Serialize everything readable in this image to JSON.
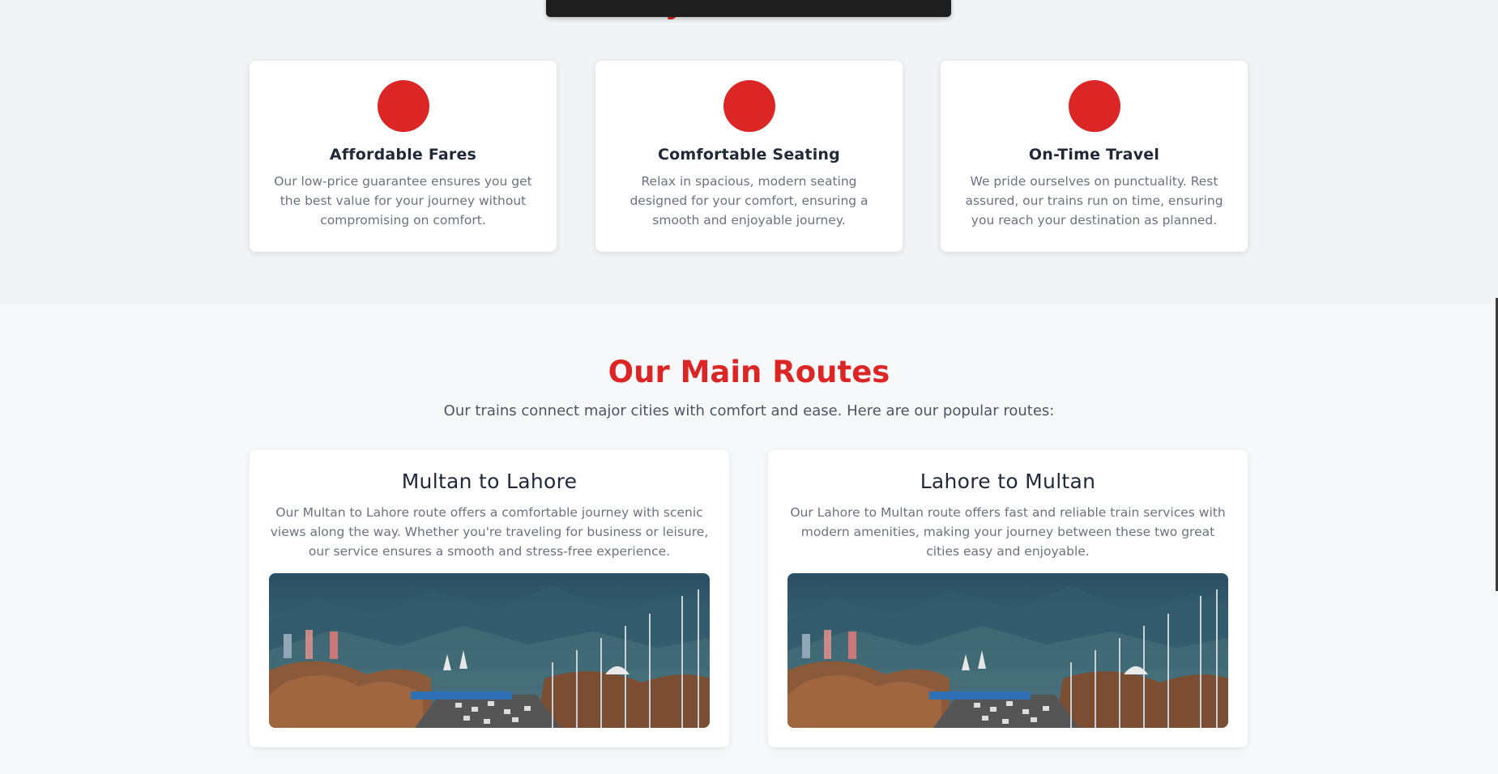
{
  "why": {
    "title": "Why Choose Us?",
    "accent_color": "#dc2626",
    "features": [
      {
        "icon": "red-circle-icon",
        "title": "Affordable Fares",
        "text": "Our low-price guarantee ensures you get the best value for your journey without compromising on comfort."
      },
      {
        "icon": "red-circle-icon",
        "title": "Comfortable Seating",
        "text": "Relax in spacious, modern seating designed for your comfort, ensuring a smooth and enjoyable journey."
      },
      {
        "icon": "red-circle-icon",
        "title": "On-Time Travel",
        "text": "We pride ourselves on punctuality. Rest assured, our trains run on time, ensuring you reach your destination as planned."
      }
    ]
  },
  "routes": {
    "title": "Our Main Routes",
    "subtitle": "Our trains connect major cities with comfort and ease. Here are our popular routes:",
    "items": [
      {
        "title": "Multan to Lahore",
        "text": "Our Multan to Lahore route offers a comfortable journey with scenic views along the way. Whether you're traveling for business or leisure, our service ensures a smooth and stress-free experience.",
        "image": "city-highway-photo"
      },
      {
        "title": "Lahore to Multan",
        "text": "Our Lahore to Multan route offers fast and reliable train services with modern amenities, making your journey between these two great cities easy and enjoyable.",
        "image": "city-highway-photo"
      }
    ]
  }
}
